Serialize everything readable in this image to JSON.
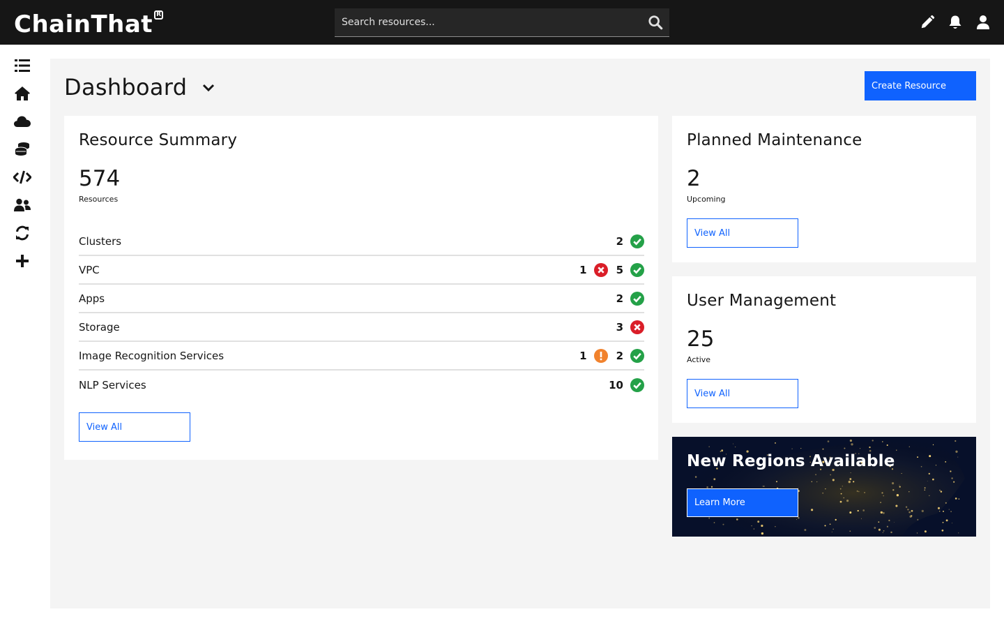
{
  "app": {
    "logo_text": "ChainThat",
    "logo_mark": "R"
  },
  "search": {
    "placeholder": "Search resources..."
  },
  "top_actions": [
    "edit-icon",
    "notification-icon",
    "user-icon"
  ],
  "sidebar": {
    "items": [
      {
        "name": "list-icon"
      },
      {
        "name": "home-icon"
      },
      {
        "name": "cloud-icon"
      },
      {
        "name": "database-icon"
      },
      {
        "name": "code-icon"
      },
      {
        "name": "users-icon"
      },
      {
        "name": "sync-icon"
      },
      {
        "name": "plus-icon"
      }
    ]
  },
  "header": {
    "title": "Dashboard",
    "create_label": "Create Resource"
  },
  "resource_summary": {
    "title": "Resource Summary",
    "total": "574",
    "total_label": "Resources",
    "rows": [
      {
        "name": "Clusters",
        "statuses": [
          {
            "count": "2",
            "status": "ok"
          }
        ]
      },
      {
        "name": "VPC",
        "statuses": [
          {
            "count": "1",
            "status": "error"
          },
          {
            "count": "5",
            "status": "ok"
          }
        ]
      },
      {
        "name": "Apps",
        "statuses": [
          {
            "count": "2",
            "status": "ok"
          }
        ]
      },
      {
        "name": "Storage",
        "statuses": [
          {
            "count": "3",
            "status": "error"
          }
        ]
      },
      {
        "name": "Image Recognition Services",
        "statuses": [
          {
            "count": "1",
            "status": "warning"
          },
          {
            "count": "2",
            "status": "ok"
          }
        ]
      },
      {
        "name": "NLP Services",
        "statuses": [
          {
            "count": "10",
            "status": "ok"
          }
        ]
      }
    ],
    "view_all_label": "View All"
  },
  "planned_maintenance": {
    "title": "Planned Maintenance",
    "count": "2",
    "count_label": "Upcoming",
    "view_all_label": "View All"
  },
  "user_management": {
    "title": "User Management",
    "count": "25",
    "count_label": "Active",
    "view_all_label": "View All"
  },
  "regions": {
    "title": "New Regions Available",
    "learn_more_label": "Learn More"
  },
  "colors": {
    "primary": "#0f62fe",
    "ok": "#24a148",
    "error": "#da1e28",
    "warning": "#f1822d",
    "topbar": "#161616"
  }
}
